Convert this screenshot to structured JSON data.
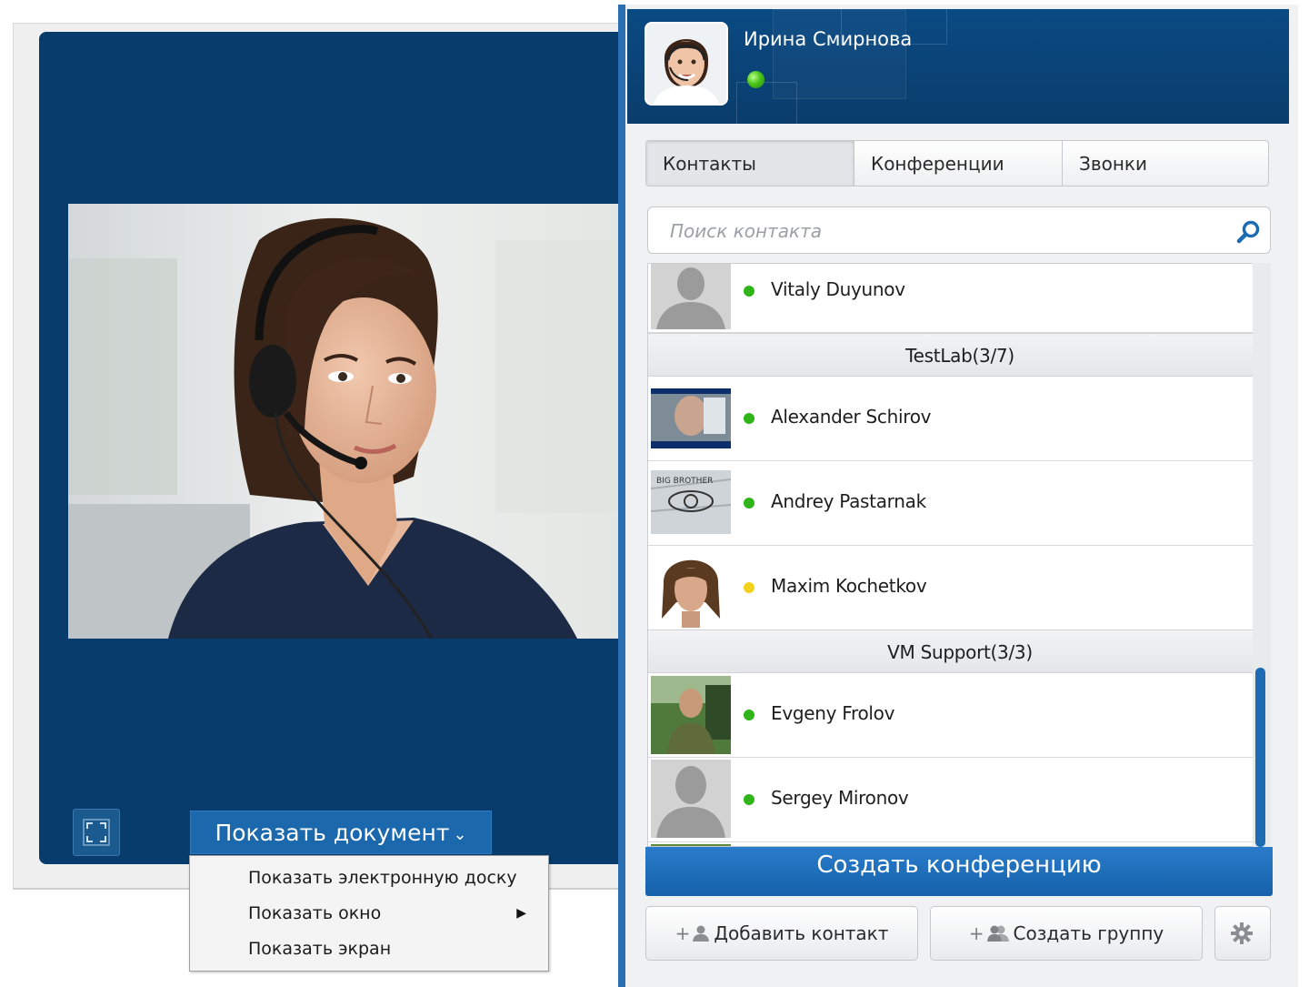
{
  "video": {
    "show_document_label": "Показать документ",
    "document_menu": [
      {
        "label": "Показать электронную доску",
        "has_submenu": false
      },
      {
        "label": "Показать окно",
        "has_submenu": true
      },
      {
        "label": "Показать экран",
        "has_submenu": false
      }
    ]
  },
  "profile": {
    "name": "Ирина Смирнова",
    "status": "online",
    "status_color": "#3cb81a"
  },
  "tabs": [
    {
      "label": "Контакты",
      "active": true
    },
    {
      "label": "Конференции",
      "active": false
    },
    {
      "label": "Звонки",
      "active": false
    }
  ],
  "search": {
    "placeholder": "Поиск контакта",
    "value": ""
  },
  "contacts": {
    "items": [
      {
        "type": "contact",
        "name": "Vitaly Duyunov",
        "status": "online",
        "avatar": "placeholder-avatar"
      },
      {
        "type": "group",
        "label": "TestLab(3/7)"
      },
      {
        "type": "contact",
        "name": "Alexander Schirov",
        "status": "online",
        "avatar": "photo-avatar"
      },
      {
        "type": "contact",
        "name": "Andrey Pastarnak",
        "status": "online",
        "avatar": "eye-avatar"
      },
      {
        "type": "contact",
        "name": "Maxim Kochetkov",
        "status": "away",
        "avatar": "photo-avatar"
      },
      {
        "type": "group",
        "label": "VM Support(3/3)"
      },
      {
        "type": "contact",
        "name": "Evgeny Frolov",
        "status": "online",
        "avatar": "photo-avatar"
      },
      {
        "type": "contact",
        "name": "Sergey Mironov",
        "status": "online",
        "avatar": "placeholder-avatar"
      }
    ]
  },
  "status_colors": {
    "online": "#2fb41a",
    "away": "#f2d21a"
  },
  "actions": {
    "create_conference": "Создать конференцию",
    "add_contact": "Добавить контакт",
    "create_group": "Создать группу",
    "settings_icon": "gear-icon"
  },
  "colors": {
    "brand_blue": "#0a4a83",
    "accent_blue": "#1d6bb3"
  }
}
